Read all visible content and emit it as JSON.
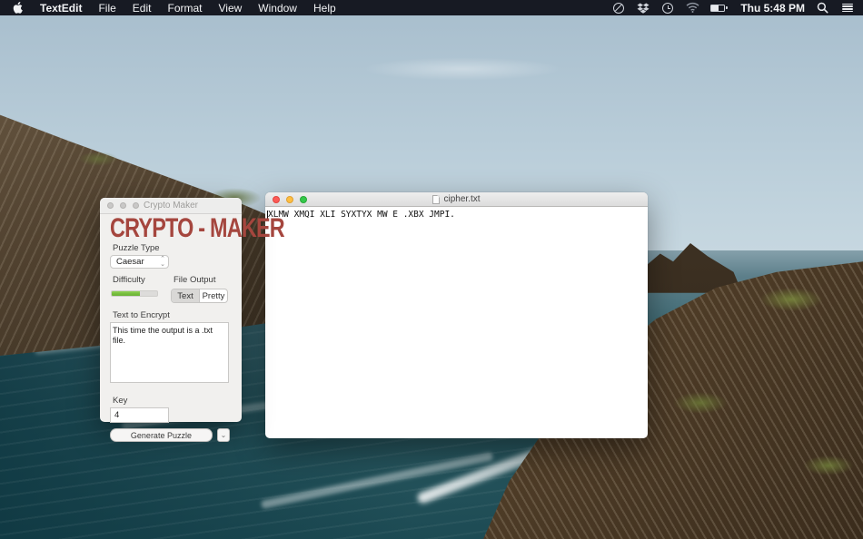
{
  "menu_bar": {
    "app_name": "TextEdit",
    "menus": [
      "File",
      "Edit",
      "Format",
      "View",
      "Window",
      "Help"
    ],
    "status": {
      "clock": "Thu 5:48 PM"
    }
  },
  "crypto_window": {
    "window_title": "Crypto Maker",
    "heading": "CRYPTO - MAKER",
    "heading_color": "#a5463e",
    "puzzle_type_label": "Puzzle Type",
    "puzzle_type_value": "Caesar",
    "difficulty_label": "Difficulty",
    "difficulty_percent": 62,
    "difficulty_fill_color": "#76bd3d",
    "file_output_label": "File Output",
    "file_output_segments": [
      "Text",
      "Pretty"
    ],
    "file_output_selected": "Text",
    "text_to_encrypt_label": "Text to Encrypt",
    "text_to_encrypt_value": "This time the output is a .txt file.",
    "key_label": "Key",
    "key_value": "4",
    "generate_button_label": "Generate Puzzle",
    "dropdown_chevron": "⌄",
    "select_up_chevron": "⌃",
    "select_down_chevron": "⌄"
  },
  "textedit_window": {
    "window_title": "cipher.txt",
    "content": "XLMW XMQI XLI SYXTYX MW E .XBX JMPI."
  }
}
